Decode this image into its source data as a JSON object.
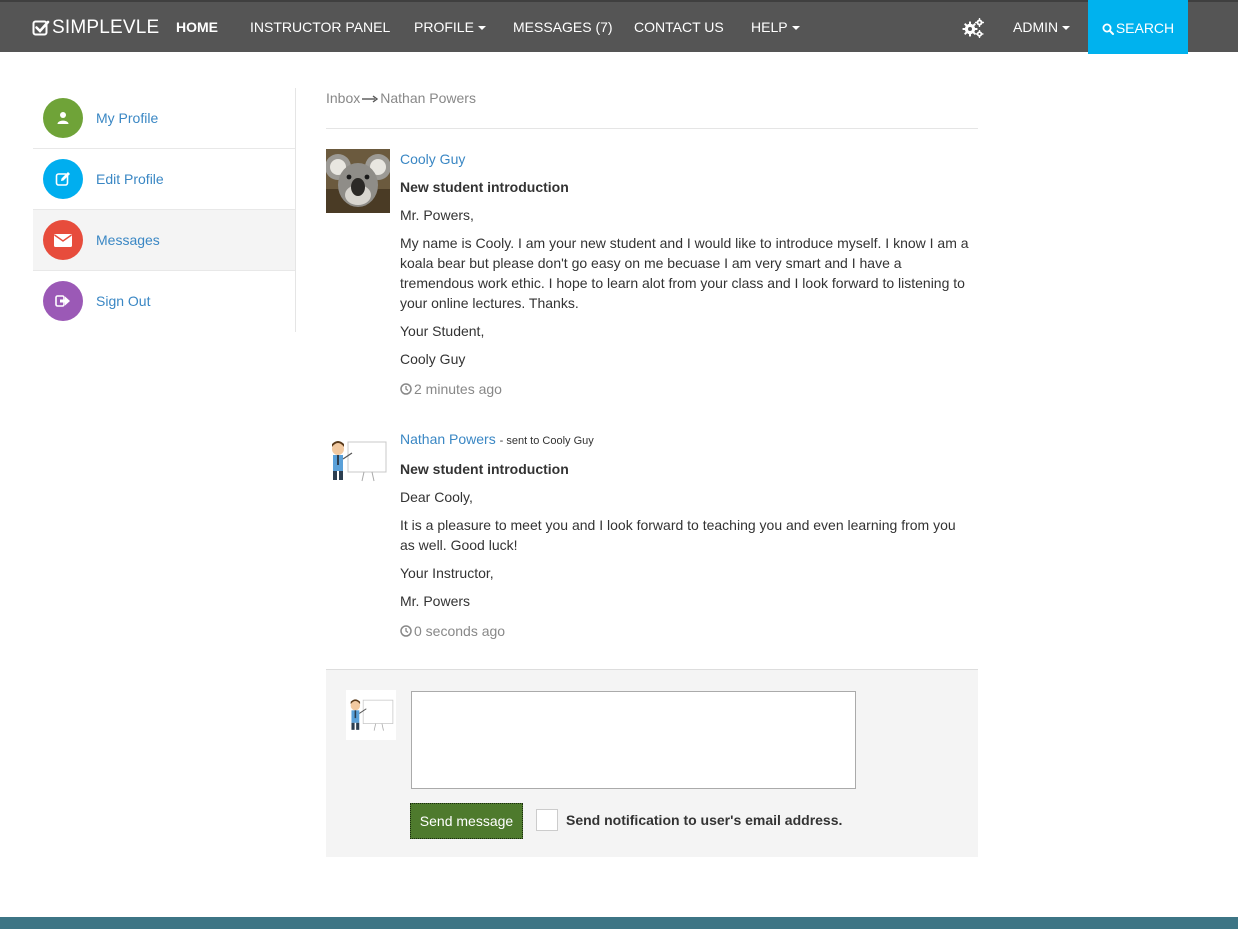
{
  "navbar": {
    "brand": "SIMPLEVLE",
    "items": [
      {
        "label": "HOME"
      },
      {
        "label": "INSTRUCTOR PANEL"
      },
      {
        "label": "PROFILE"
      },
      {
        "label": "MESSAGES (7)"
      },
      {
        "label": "CONTACT US"
      },
      {
        "label": "HELP"
      }
    ],
    "admin_label": "ADMIN",
    "search_label": "SEARCH",
    "colors": {
      "bar": "#555555",
      "search": "#00b2ee"
    }
  },
  "sidebar": {
    "items": [
      {
        "label": "My Profile",
        "icon": "user-icon",
        "color": "#6fa338"
      },
      {
        "label": "Edit Profile",
        "icon": "edit-icon",
        "color": "#00aeef"
      },
      {
        "label": "Messages",
        "icon": "envelope-icon",
        "color": "#e74c3c"
      },
      {
        "label": "Sign Out",
        "icon": "sign-out-icon",
        "color": "#9b59b6"
      }
    ]
  },
  "breadcrumb": {
    "root": "Inbox",
    "current": "Nathan Powers"
  },
  "messages": [
    {
      "sender": "Cooly Guy",
      "sent_to": "",
      "subject": "New student introduction",
      "greeting": "Mr. Powers,",
      "body": "My name is Cooly. I am your new student and I would like to introduce myself. I know I am a koala bear but please don't go easy on me becuase I am very smart and I have a tremendous work ethic. I hope to learn alot from your class and I look forward to listening to your online lectures. Thanks.",
      "closing": "Your Student,",
      "signature": "Cooly Guy",
      "time": "2 minutes ago"
    },
    {
      "sender": "Nathan Powers",
      "sent_to": "- sent to Cooly Guy",
      "subject": "New student introduction",
      "greeting": "Dear Cooly,",
      "body": "It is a pleasure to meet you and I look forward to teaching you and even learning from you as well. Good luck!",
      "closing": "Your Instructor,",
      "signature": "Mr. Powers",
      "time": "0 seconds ago"
    }
  ],
  "reply": {
    "value": "",
    "send_label": "Send message",
    "notify_label": "Send notification to user's email address.",
    "notify_checked": false,
    "send_color": "#4e7a2d"
  },
  "footer": {
    "color": "#3d7585"
  }
}
